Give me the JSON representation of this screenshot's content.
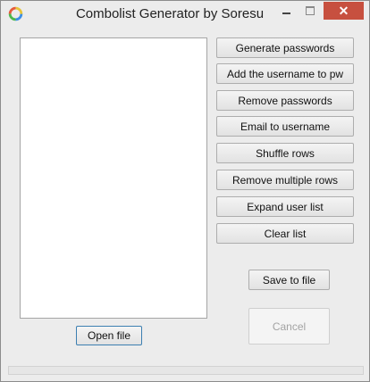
{
  "window": {
    "title": "Combolist Generator by Soresu",
    "close_glyph": "✕",
    "icons": [
      "app-icon",
      "minimize-icon",
      "maximize-icon",
      "close-icon"
    ]
  },
  "buttons": {
    "generate_passwords": "Generate passwords",
    "add_username_to_pw": "Add the username to pw",
    "remove_passwords": "Remove passwords",
    "email_to_username": "Email to username",
    "shuffle_rows": "Shuffle rows",
    "remove_multiple_rows": "Remove multiple rows",
    "expand_user_list": "Expand user list",
    "clear_list": "Clear list",
    "save_to_file": "Save to file",
    "cancel": "Cancel",
    "open_file": "Open file"
  },
  "states": {
    "cancel_enabled": false
  },
  "colors": {
    "close_button": "#c7503f",
    "background": "#ececec"
  }
}
